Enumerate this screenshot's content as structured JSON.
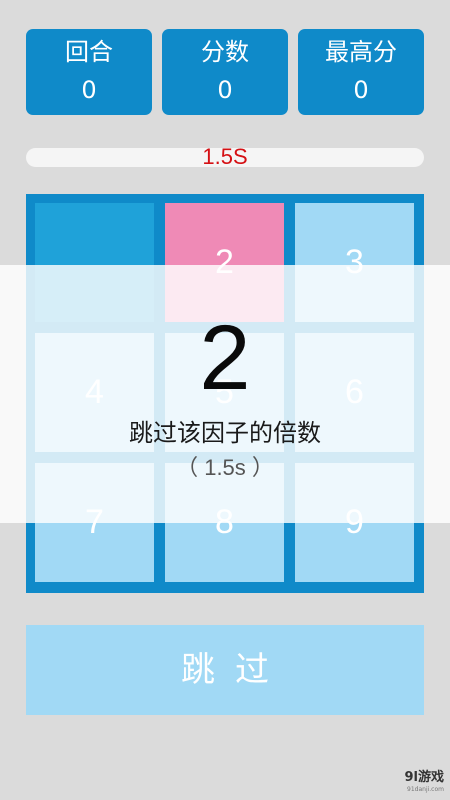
{
  "stats": {
    "round": {
      "label": "回合",
      "value": "0"
    },
    "score": {
      "label": "分数",
      "value": "0"
    },
    "best": {
      "label": "最高分",
      "value": "0"
    }
  },
  "timer": {
    "text": "1.5S",
    "color": "#d51014"
  },
  "grid": {
    "cells": [
      {
        "number": "",
        "state": "dark"
      },
      {
        "number": "2",
        "state": "pink"
      },
      {
        "number": "3",
        "state": "normal"
      },
      {
        "number": "4",
        "state": "normal"
      },
      {
        "number": "5",
        "state": "normal"
      },
      {
        "number": "6",
        "state": "normal"
      },
      {
        "number": "7",
        "state": "normal"
      },
      {
        "number": "8",
        "state": "normal"
      },
      {
        "number": "9",
        "state": "normal"
      }
    ]
  },
  "overlay": {
    "factor": "2",
    "hint": "跳过该因子的倍数",
    "time": "（ 1.5s ）"
  },
  "skip_button": {
    "label": "跳过"
  },
  "watermark": {
    "brand": "9l游戏",
    "site": "91danji.com"
  },
  "colors": {
    "accent": "#0f8ac9",
    "cell": "#a1d9f5",
    "cell_dark": "#1fa2d9",
    "cell_highlight": "#ef8ab6",
    "background": "#dbdbdb"
  }
}
